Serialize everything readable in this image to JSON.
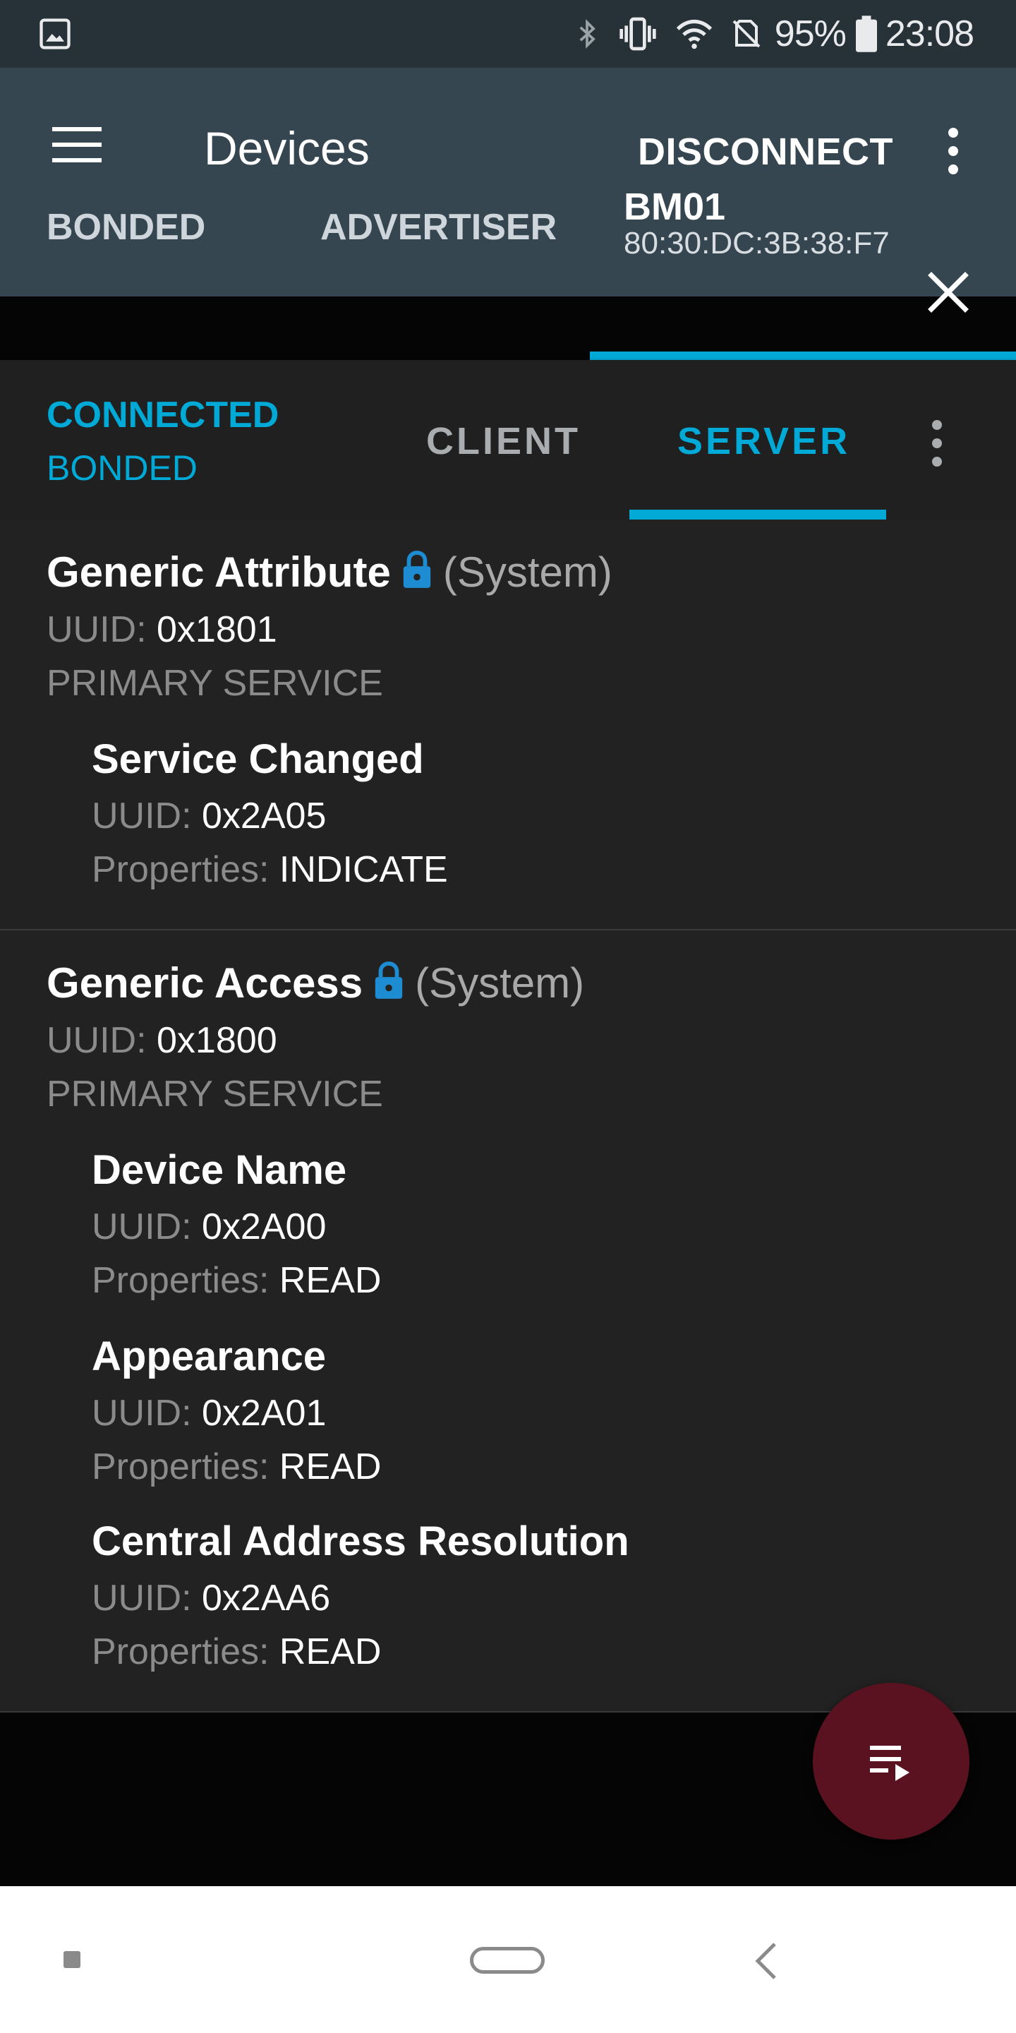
{
  "status_bar": {
    "battery_percent": "95%",
    "time": "23:08",
    "icons": [
      "image-icon",
      "bluetooth-icon",
      "vibrate-icon",
      "wifi-icon",
      "no-sim-icon",
      "battery-icon"
    ]
  },
  "app_bar": {
    "title": "Devices",
    "disconnect_label": "DISCONNECT",
    "icons": [
      "menu-icon",
      "more-vert-icon"
    ]
  },
  "device_tabs": {
    "bonded": "BONDED",
    "advertiser": "ADVERTISER",
    "active_name": "BM01",
    "active_address": "80:30:DC:3B:38:F7"
  },
  "connection": {
    "state": "CONNECTED",
    "bond_state": "BONDED",
    "tabs": [
      "CLIENT",
      "SERVER"
    ],
    "selected_tab": "SERVER"
  },
  "services": [
    {
      "name": "Generic Attribute",
      "tag": "(System)",
      "uuid_label": "UUID:",
      "uuid": "0x1801",
      "type": "PRIMARY SERVICE",
      "characteristics": [
        {
          "name": "Service Changed",
          "uuid_label": "UUID:",
          "uuid": "0x2A05",
          "props_label": "Properties:",
          "properties": "INDICATE"
        }
      ]
    },
    {
      "name": "Generic Access",
      "tag": "(System)",
      "uuid_label": "UUID:",
      "uuid": "0x1800",
      "type": "PRIMARY SERVICE",
      "characteristics": [
        {
          "name": "Device Name",
          "uuid_label": "UUID:",
          "uuid": "0x2A00",
          "props_label": "Properties:",
          "properties": "READ"
        },
        {
          "name": "Appearance",
          "uuid_label": "UUID:",
          "uuid": "0x2A01",
          "props_label": "Properties:",
          "properties": "READ"
        },
        {
          "name": "Central Address Resolution",
          "uuid_label": "UUID:",
          "uuid": "0x2AA6",
          "props_label": "Properties:",
          "properties": "READ"
        }
      ]
    }
  ],
  "colors": {
    "accent": "#00a9d6",
    "app_bar": "#364651",
    "status_bar": "#263138",
    "fab": "#5b1220",
    "content_bg": "#222222"
  }
}
